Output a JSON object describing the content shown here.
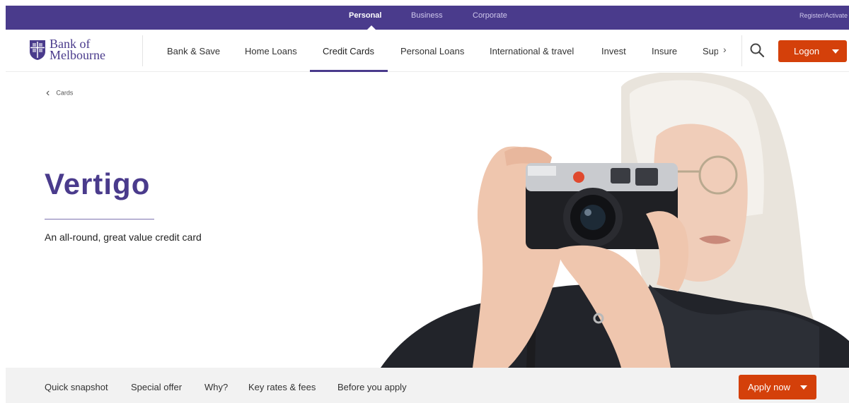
{
  "segments": {
    "personal": "Personal",
    "business": "Business",
    "corporate": "Corporate",
    "register": "Register/Activate"
  },
  "brand": {
    "line1": "Bank of",
    "line2": "Melbourne",
    "color": "#4a3b8c"
  },
  "nav": {
    "items": [
      "Bank & Save",
      "Home Loans",
      "Credit Cards",
      "Personal Loans",
      "International & travel",
      "Invest",
      "Insure",
      "Sup"
    ],
    "active": "Credit Cards",
    "more_icon": "chevron-right-icon",
    "search_icon": "search-icon",
    "logon": "Logon"
  },
  "hero": {
    "back": "Cards",
    "title": "Vertigo",
    "subtitle": "An all-round, great value credit card"
  },
  "subnav": {
    "items": [
      "Quick snapshot",
      "Special offer",
      "Why?",
      "Key rates & fees",
      "Before you apply"
    ],
    "apply": "Apply now"
  },
  "colors": {
    "accent": "#4a3b8c",
    "cta": "#d4400a"
  }
}
